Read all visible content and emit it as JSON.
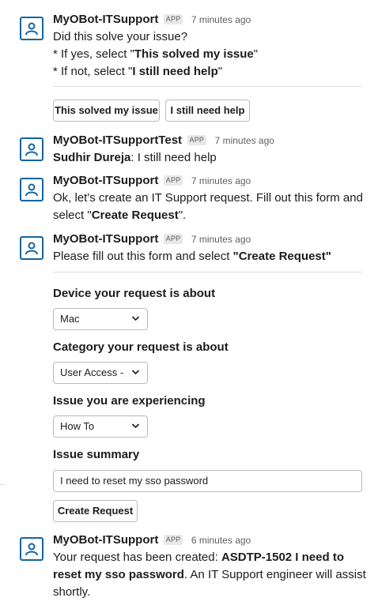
{
  "messages": {
    "m1": {
      "name": "MyOBot-ITSupport",
      "badge": "APP",
      "time": "7 minutes ago",
      "line1": "Did this solve your issue?",
      "b1_pre": " * If yes, select \"",
      "b1_bold": "This solved my issue",
      "b1_post": "\"",
      "b2_pre": " * If not, select \"",
      "b2_bold": "I still need help",
      "b2_post": "\"",
      "btn_solved": "This solved my issue",
      "btn_help": "I still need help"
    },
    "m2": {
      "name": "MyOBot-ITSupportTest",
      "badge": "APP",
      "time": "7 minutes ago",
      "user": "Sudhir Dureja",
      "text": ": I still need help"
    },
    "m3": {
      "name": "MyOBot-ITSupport",
      "badge": "APP",
      "time": "7 minutes ago",
      "line1": "Ok, let's create an IT Support request. Fill out this form and",
      "line2_pre": "select \"",
      "line2_bold": "Create Request",
      "line2_post": "\"."
    },
    "m4": {
      "name": "MyOBot-ITSupport",
      "badge": "APP",
      "time": "7 minutes ago",
      "text_pre": "Please fill out this form and select ",
      "text_bold": "\"Create Request\""
    },
    "m5": {
      "name": "MyOBot-ITSupport",
      "badge": "APP",
      "time": "6 minutes ago",
      "line1_pre": "Your request has been created: ",
      "line1_bold": "ASDTP-1502 I need to",
      "line2_bold": "reset my sso password",
      "line2_post": ". An IT Support engineer will assist",
      "line3": "shortly."
    }
  },
  "form": {
    "device_label": "Device your request is about",
    "device_value": "Mac",
    "category_label": "Category your request is about",
    "category_value": "User Access - V",
    "issue_label": "Issue you are experiencing",
    "issue_value": "How To",
    "summary_label": "Issue summary",
    "summary_value": "I need to reset my sso password",
    "submit_label": "Create Request"
  },
  "icons": {
    "avatar": "user-avatar-icon",
    "chevron": "chevron-down-icon"
  },
  "colors": {
    "accent": "#1264a3"
  }
}
